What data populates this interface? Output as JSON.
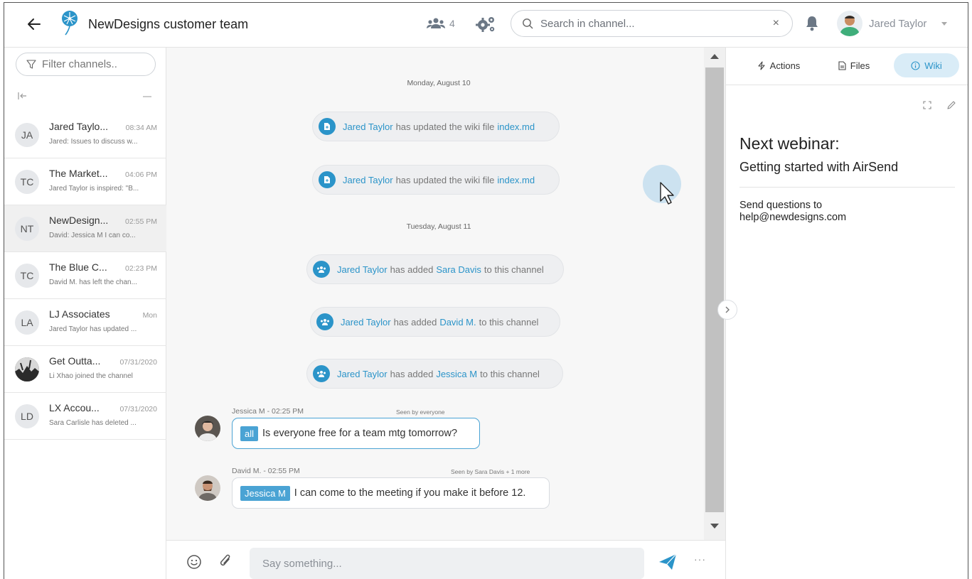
{
  "header": {
    "channel_title": "NewDesigns customer team",
    "member_count": "4",
    "search_placeholder": "Search in channel...",
    "search_clear": "×",
    "user_name": "Jared Taylor"
  },
  "sidebar": {
    "filter_placeholder": "Filter channels..",
    "channels": [
      {
        "initials": "JA",
        "name": "Jared Taylo...",
        "time": "08:34 AM",
        "preview": "Jared: Issues to discuss w..."
      },
      {
        "initials": "TC",
        "name": "The Market...",
        "time": "04:06 PM",
        "preview": "Jared Taylor is inspired: \"B..."
      },
      {
        "initials": "NT",
        "name": "NewDesign...",
        "time": "02:55 PM",
        "preview": "David: Jessica M I can co..."
      },
      {
        "initials": "TC",
        "name": "The Blue C...",
        "time": "02:23 PM",
        "preview": "David M. has left the chan..."
      },
      {
        "initials": "LA",
        "name": "LJ Associates",
        "time": "Mon",
        "preview": "Jared Taylor has updated ..."
      },
      {
        "initials": "",
        "name": "Get Outta...",
        "time": "07/31/2020",
        "preview": "Li Xhao joined the channel"
      },
      {
        "initials": "LD",
        "name": "LX Accou...",
        "time": "07/31/2020",
        "preview": "Sara Carlisle has deleted ..."
      }
    ]
  },
  "chat": {
    "date_1": "Monday, August 10",
    "date_2": "Tuesday, August 11",
    "events": [
      {
        "who": "Jared Taylor",
        "mid": "has updated the wiki file",
        "target": "index.md",
        "tail": ""
      },
      {
        "who": "Jared Taylor",
        "mid": "has updated the wiki file",
        "target": "index.md",
        "tail": ""
      },
      {
        "who": "Jared Taylor",
        "mid": "has added",
        "target": "Sara Davis",
        "tail": "to this channel"
      },
      {
        "who": "Jared Taylor",
        "mid": "has added",
        "target": "David M.",
        "tail": "to this channel"
      },
      {
        "who": "Jared Taylor",
        "mid": "has added",
        "target": "Jessica M",
        "tail": "to this channel"
      }
    ],
    "messages": [
      {
        "meta": "Jessica M - 02:25 PM",
        "seen": "Seen by everyone",
        "mention": "all",
        "text": "Is everyone free for a team mtg tomorrow?"
      },
      {
        "meta": "David M. - 02:55 PM",
        "seen": "Seen by Sara Davis + 1 more",
        "mention": "Jessica M",
        "text": "I can come to the meeting if you make it before 12."
      }
    ],
    "composer_placeholder": "Say something...",
    "more_label": "···"
  },
  "right_panel": {
    "tabs": [
      {
        "label": "Actions",
        "icon": "lightning-icon"
      },
      {
        "label": "Files",
        "icon": "file-icon"
      },
      {
        "label": "Wiki",
        "icon": "info-icon",
        "active": true
      }
    ],
    "wiki": {
      "heading": "Next webinar:",
      "subheading": "Getting started with AirSend",
      "line_1": "Send questions to",
      "line_2": "help@newdesigns.com"
    }
  },
  "colors": {
    "accent": "#2b94c9",
    "mention_bg": "#4aa3d4",
    "active_tab_bg": "#d9ecf7"
  }
}
